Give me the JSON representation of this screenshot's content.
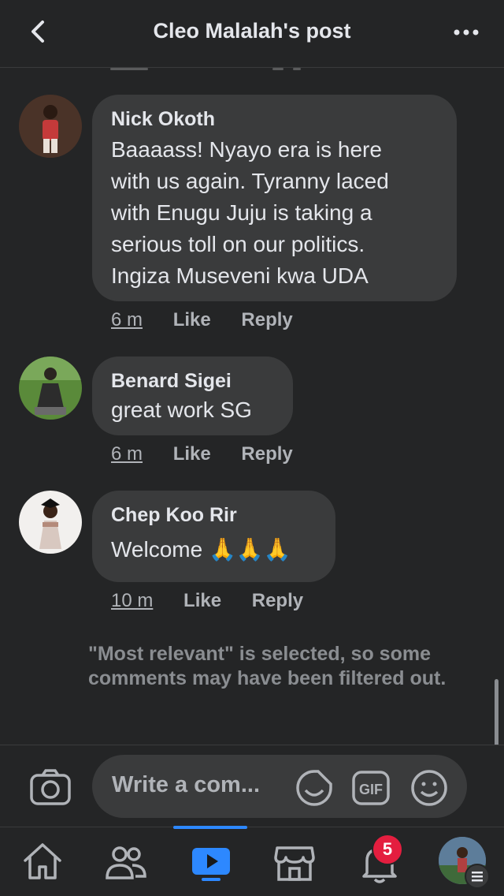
{
  "header": {
    "title": "Cleo Malalah's post",
    "back_icon": "chevron-left-icon",
    "more_icon": "more-horizontal-icon"
  },
  "comments": [
    {
      "author": "Nick Okoth",
      "lines": [
        "Baaaass! Nyayo era is here",
        "with us again. Tyranny laced",
        "with Enugu Juju is taking a",
        "serious toll on our politics.",
        "Ingiza Museveni kwa UDA"
      ],
      "time": "6 m",
      "like": "Like",
      "reply": "Reply"
    },
    {
      "author": "Benard Sigei",
      "lines": [
        "great work SG"
      ],
      "time": "6 m",
      "like": "Like",
      "reply": "Reply"
    },
    {
      "author": "Chep Koo Rir",
      "lines": [
        "Welcome 🙏🙏🙏"
      ],
      "time": "10 m",
      "like": "Like",
      "reply": "Reply"
    }
  ],
  "notice": "\"Most relevant\" is selected, so some comments may have been filtered out.",
  "composer": {
    "placeholder": "Write a com...",
    "icons": [
      "camera-icon",
      "sticker-icon",
      "gif-icon",
      "emoji-icon"
    ]
  },
  "tabbar": {
    "tabs": [
      "home-icon",
      "friends-icon",
      "watch-icon",
      "marketplace-icon",
      "notifications-icon",
      "profile-menu-icon"
    ],
    "active_tab": "watch-icon",
    "notification_count": "5"
  },
  "colors": {
    "background": "#242526",
    "bubble": "#3a3b3c",
    "accent": "#2d88ff",
    "badge": "#e41e3f"
  }
}
